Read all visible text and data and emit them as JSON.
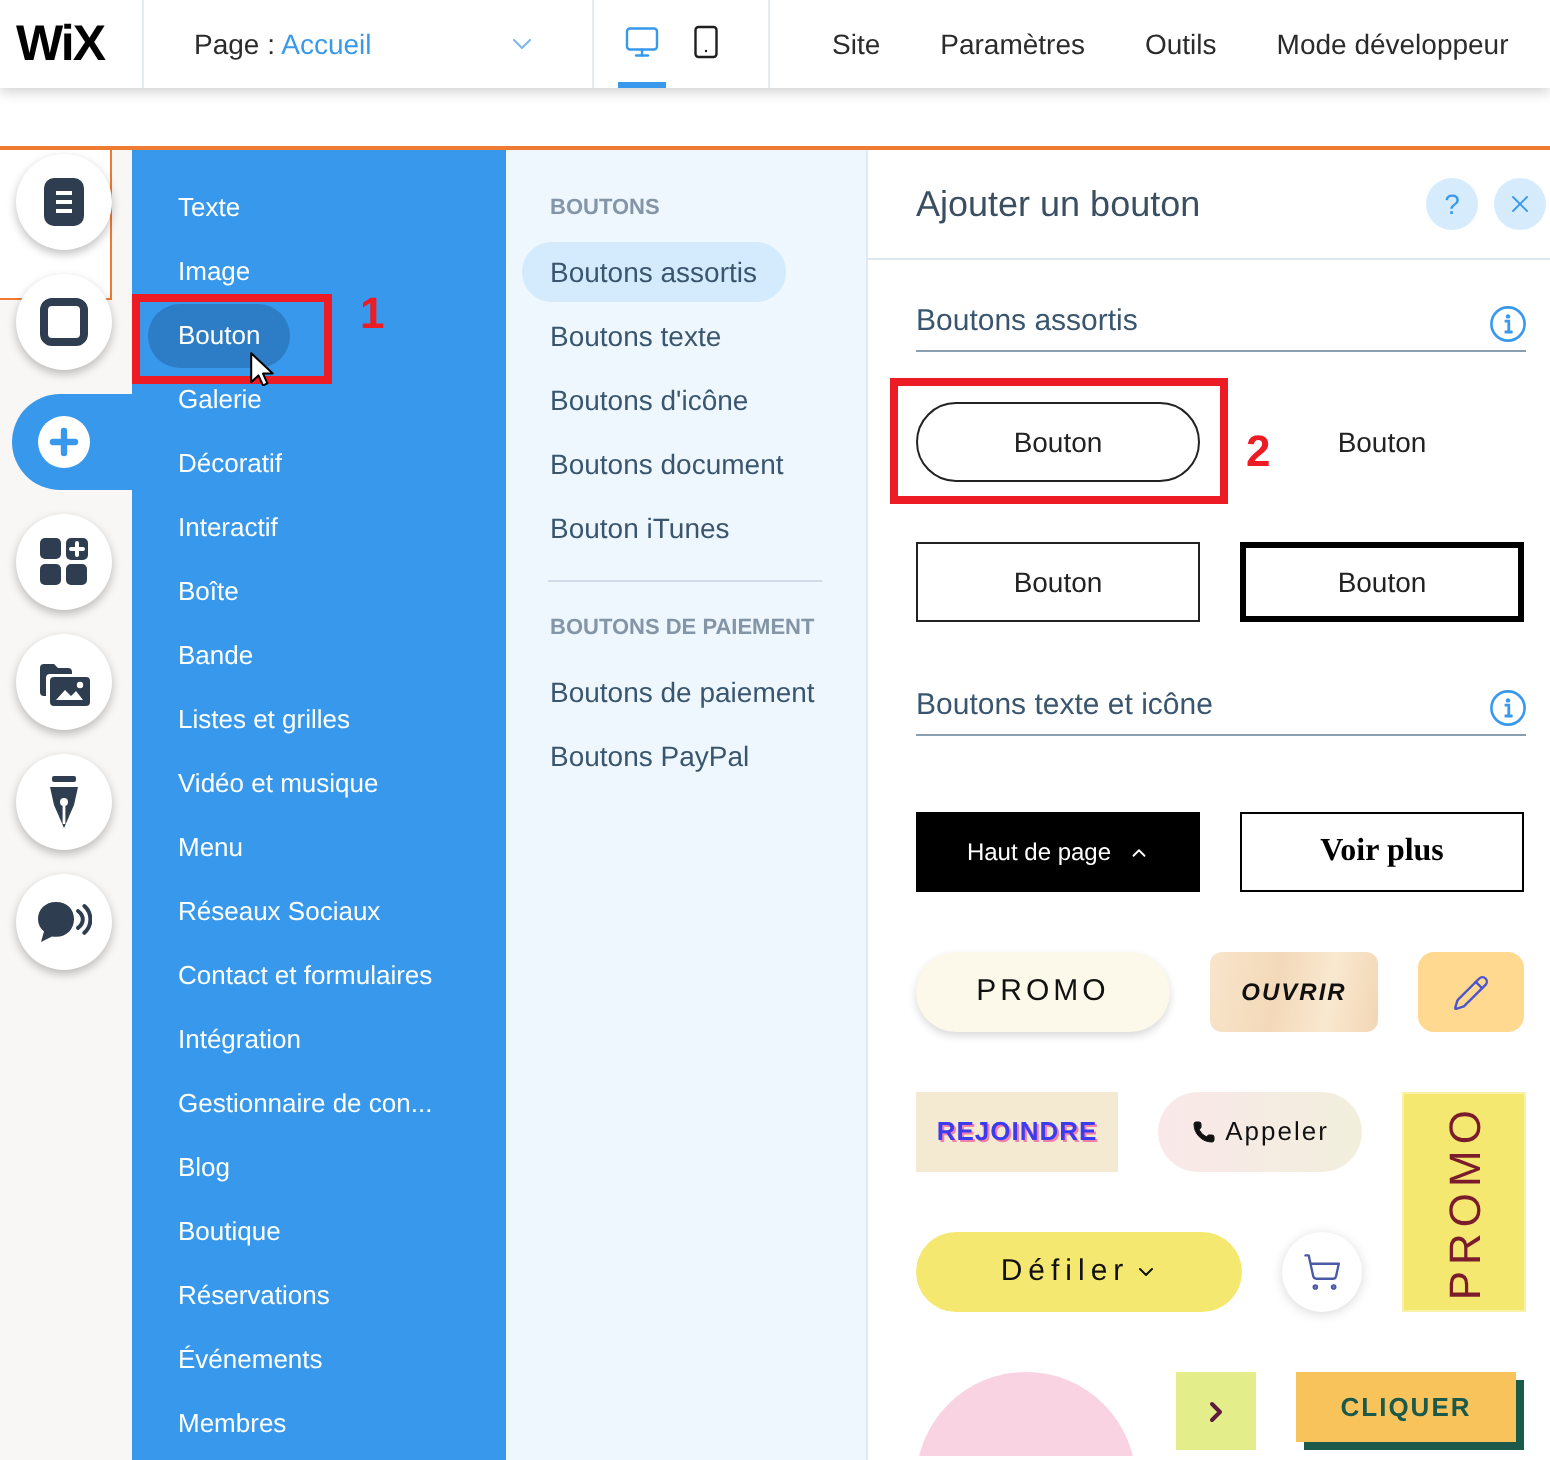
{
  "top_bar": {
    "logo": "WiX",
    "page_label": "Page :",
    "page_name": "Accueil",
    "devices": [
      {
        "kind": "desktop",
        "selected": true
      },
      {
        "kind": "mobile",
        "selected": false
      }
    ],
    "menu": [
      "Site",
      "Paramètres",
      "Outils",
      "Mode développeur"
    ]
  },
  "tool_rail": [
    {
      "kind": "pages",
      "selected": false
    },
    {
      "kind": "background",
      "selected": false
    },
    {
      "kind": "add",
      "selected": true
    },
    {
      "kind": "apps",
      "selected": false
    },
    {
      "kind": "media",
      "selected": false
    },
    {
      "kind": "blog",
      "selected": false
    },
    {
      "kind": "chat",
      "selected": false
    }
  ],
  "add_menu": [
    {
      "label": "Texte",
      "selected": false
    },
    {
      "label": "Image",
      "selected": false
    },
    {
      "label": "Bouton",
      "selected": true
    },
    {
      "label": "Galerie",
      "selected": false
    },
    {
      "label": "Décoratif",
      "selected": false
    },
    {
      "label": "Interactif",
      "selected": false
    },
    {
      "label": "Boîte",
      "selected": false
    },
    {
      "label": "Bande",
      "selected": false
    },
    {
      "label": "Listes et grilles",
      "selected": false
    },
    {
      "label": "Vidéo et musique",
      "selected": false
    },
    {
      "label": "Menu",
      "selected": false
    },
    {
      "label": "Réseaux Sociaux",
      "selected": false
    },
    {
      "label": "Contact et formulaires",
      "selected": false
    },
    {
      "label": "Intégration",
      "selected": false
    },
    {
      "label": "Gestionnaire de con...",
      "selected": false
    },
    {
      "label": "Blog",
      "selected": false
    },
    {
      "label": "Boutique",
      "selected": false
    },
    {
      "label": "Réservations",
      "selected": false
    },
    {
      "label": "Événements",
      "selected": false
    },
    {
      "label": "Membres",
      "selected": false
    }
  ],
  "categories": [
    {
      "heading": "BOUTONS",
      "items": [
        {
          "label": "Boutons assortis",
          "selected": true
        },
        {
          "label": "Boutons texte",
          "selected": false
        },
        {
          "label": "Boutons d'icône",
          "selected": false
        },
        {
          "label": "Boutons document",
          "selected": false
        },
        {
          "label": "Bouton iTunes",
          "selected": false
        }
      ]
    },
    {
      "heading": "BOUTONS DE PAIEMENT",
      "items": [
        {
          "label": "Boutons de paiement",
          "selected": false
        },
        {
          "label": "Boutons PayPal",
          "selected": false
        }
      ]
    }
  ],
  "panel": {
    "title": "Ajouter un bouton",
    "help": "?",
    "sections": [
      {
        "title": "Boutons assortis",
        "rows": [
          {
            "buttons": [
              {
                "kind": "pill-outline",
                "label": "Bouton"
              },
              {
                "kind": "plain",
                "label": "Bouton"
              }
            ]
          },
          {
            "buttons": [
              {
                "kind": "box-outline",
                "label": "Bouton"
              },
              {
                "kind": "box-thick",
                "label": "Bouton"
              }
            ]
          }
        ]
      },
      {
        "title": "Boutons texte et icône",
        "rows": [
          {
            "buttons": [
              {
                "kind": "dark",
                "label": "Haut de page"
              },
              {
                "kind": "serif-outline",
                "label": "Voir plus"
              }
            ]
          },
          {
            "buttons": [
              {
                "kind": "promo-pill",
                "label": "PROMO"
              },
              {
                "kind": "wood",
                "label": "OUVRIR"
              },
              {
                "kind": "pencil"
              }
            ]
          },
          {
            "buttons": [
              {
                "kind": "label-tile",
                "label": "REJOINDRE"
              },
              {
                "kind": "call",
                "label": "Appeler"
              },
              {
                "kind": "promo-vertical",
                "label": "PROMO"
              }
            ]
          },
          {
            "buttons": [
              {
                "kind": "scroll-pill",
                "label": "Défiler"
              },
              {
                "kind": "cart"
              }
            ]
          },
          {
            "buttons": [
              {
                "kind": "circle"
              },
              {
                "kind": "arrow-tile"
              },
              {
                "kind": "offset-shadow",
                "label": "CLIQUER"
              }
            ]
          }
        ]
      }
    ]
  },
  "annotations": [
    {
      "label": "1"
    },
    {
      "label": "2"
    }
  ]
}
